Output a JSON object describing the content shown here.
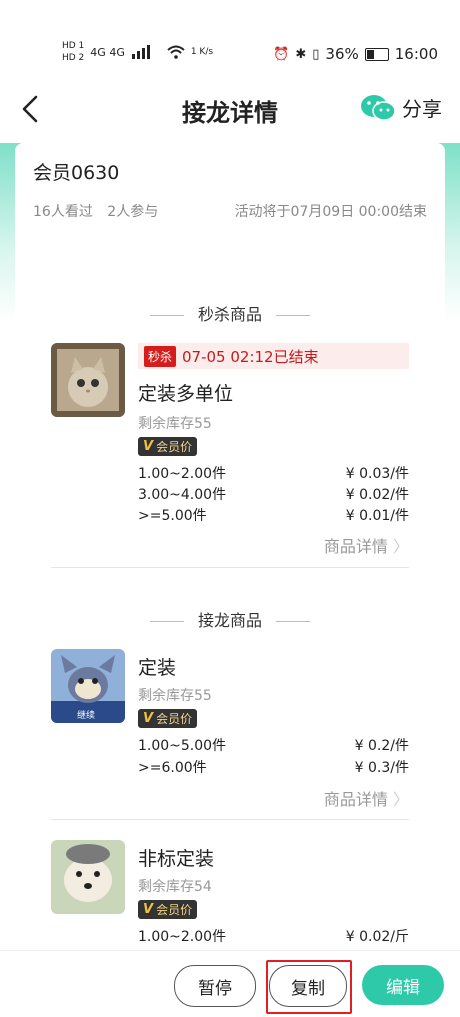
{
  "status": {
    "hd1": "HD 1",
    "hd2": "HD 2",
    "net": "4G 4G",
    "speed": "1 K/s",
    "battery": "36%",
    "time": "16:00"
  },
  "nav": {
    "title": "接龙详情",
    "share": "分享"
  },
  "info": {
    "member": "会员0630",
    "views": "16人看过",
    "participants": "2人参与",
    "end": "活动将于07月09日 00:00结束"
  },
  "sections": {
    "flash": "秒杀商品",
    "relay": "接龙商品"
  },
  "flash_product": {
    "tag": "秒杀",
    "status": "07-05 02:12已结束",
    "name": "定装多单位",
    "stock": "剩余库存55",
    "badge": "会员价",
    "tiers": [
      {
        "qty": "1.00~2.00件",
        "price": "¥ 0.03/件"
      },
      {
        "qty": "3.00~4.00件",
        "price": "¥ 0.02/件"
      },
      {
        "qty": ">=5.00件",
        "price": "¥ 0.01/件"
      }
    ],
    "detail": "商品详情"
  },
  "relay_products": [
    {
      "name": "定装",
      "stock": "剩余库存55",
      "badge": "会员价",
      "thumb_caption": "继续",
      "tiers": [
        {
          "qty": "1.00~5.00件",
          "price": "¥ 0.2/件"
        },
        {
          "qty": ">=6.00件",
          "price": "¥ 0.3/件"
        }
      ],
      "detail": "商品详情"
    },
    {
      "name": "非标定装",
      "stock": "剩余库存54",
      "badge": "会员价",
      "tiers": [
        {
          "qty": "1.00~2.00件",
          "price": "¥ 0.02/斤"
        }
      ]
    }
  ],
  "buttons": {
    "pause": "暂停",
    "copy": "复制",
    "edit": "编辑"
  },
  "colors": {
    "accent": "#2ec9a8",
    "flash_red": "#d51d1d"
  }
}
